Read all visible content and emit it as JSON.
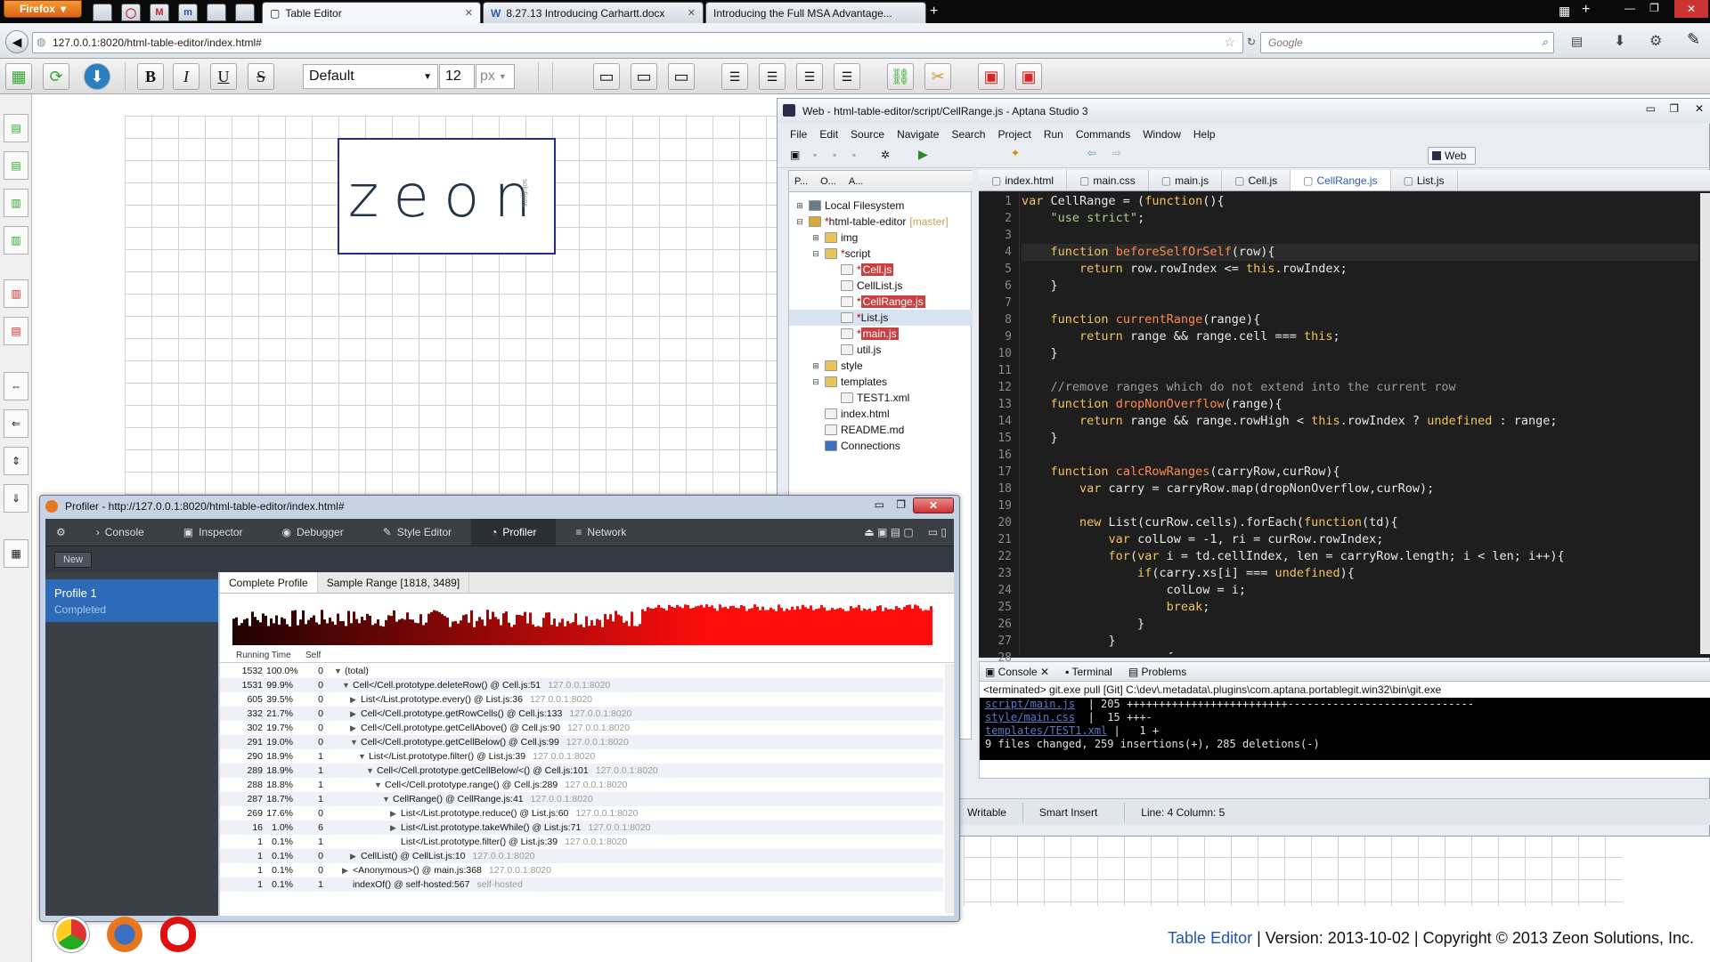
{
  "browser": {
    "menu_label": "Firefox",
    "pinned": [
      "",
      "",
      "M",
      "m",
      "",
      ""
    ],
    "tabs": [
      {
        "label": "Table Editor",
        "active": true
      },
      {
        "label": "8.27.13 Introducing Carhartt.docx",
        "active": false
      },
      {
        "label": "Introducing the Full MSA Advantage...",
        "active": false
      }
    ],
    "url": "127.0.0.1:8020/html-table-editor/index.html#",
    "search_placeholder": "Google"
  },
  "toolbar": {
    "bold": "B",
    "italic": "I",
    "underline": "U",
    "strike": "S",
    "font": "Default",
    "font_size": "12",
    "unit": "px"
  },
  "logo": {
    "text": "zeon",
    "tagline": "solutions"
  },
  "aptana": {
    "title": "Web - html-table-editor/script/CellRange.js - Aptana Studio 3",
    "menu": [
      "File",
      "Edit",
      "Source",
      "Navigate",
      "Search",
      "Project",
      "Run",
      "Commands",
      "Window",
      "Help"
    ],
    "perspective": "Web",
    "project_tabs": [
      "P...",
      "O...",
      "A..."
    ],
    "tree": [
      {
        "indent": 0,
        "tw": "⊞",
        "label": "Local Filesystem",
        "color": "#6b7b8c"
      },
      {
        "indent": 0,
        "tw": "⊟",
        "label": "html-table-editor",
        "suffix": "[master]",
        "mod": true,
        "color": "#d8a93a"
      },
      {
        "indent": 1,
        "tw": "⊞",
        "label": "img",
        "color": "#e6c45a"
      },
      {
        "indent": 1,
        "tw": "⊟",
        "label": "script",
        "mod": true,
        "color": "#e6c45a"
      },
      {
        "indent": 2,
        "tw": "",
        "label": "Cell.js",
        "mod": true,
        "hl": true,
        "color": "#f2f2f2"
      },
      {
        "indent": 2,
        "tw": "",
        "label": "CellList.js",
        "color": "#f2f2f2"
      },
      {
        "indent": 2,
        "tw": "",
        "label": "CellRange.js",
        "mod": true,
        "hl": true,
        "color": "#f2f2f2"
      },
      {
        "indent": 2,
        "tw": "",
        "label": "List.js",
        "mod": true,
        "sel": true,
        "color": "#f2f2f2"
      },
      {
        "indent": 2,
        "tw": "",
        "label": "main.js",
        "mod": true,
        "hl": true,
        "color": "#f2f2f2"
      },
      {
        "indent": 2,
        "tw": "",
        "label": "util.js",
        "color": "#f2f2f2"
      },
      {
        "indent": 1,
        "tw": "⊞",
        "label": "style",
        "color": "#e6c45a"
      },
      {
        "indent": 1,
        "tw": "⊟",
        "label": "templates",
        "color": "#e6c45a"
      },
      {
        "indent": 2,
        "tw": "",
        "label": "TEST1.xml",
        "color": "#f2f2f2"
      },
      {
        "indent": 1,
        "tw": "",
        "label": "index.html",
        "color": "#f2f2f2"
      },
      {
        "indent": 1,
        "tw": "",
        "label": "README.md",
        "color": "#f2f2f2"
      },
      {
        "indent": 1,
        "tw": "",
        "label": "Connections",
        "color": "#3a6fc2"
      }
    ],
    "editor_tabs": [
      {
        "label": "index.html",
        "active": false
      },
      {
        "label": "main.css",
        "active": false
      },
      {
        "label": "main.js",
        "active": false
      },
      {
        "label": "Cell.js",
        "active": false
      },
      {
        "label": "CellRange.js",
        "active": true
      },
      {
        "label": "List.js",
        "active": false
      }
    ],
    "code_lines": [
      "1",
      "2",
      "3",
      "4",
      "5",
      "6",
      "7",
      "8",
      "9",
      "10",
      "11",
      "12",
      "13",
      "14",
      "15",
      "16",
      "17",
      "18",
      "19",
      "20",
      "21",
      "22",
      "23",
      "24",
      "25",
      "26",
      "27",
      "28"
    ],
    "console_tabs": [
      "Console",
      "Terminal",
      "Problems"
    ],
    "console_header": "<terminated> git.exe pull [Git] C:\\dev\\.metadata\\.plugins\\com.aptana.portablegit.win32\\bin\\git.exe",
    "console_rows": [
      {
        "file": "script/main.js",
        "rest": "  | 205 +++++++++++++++++++++++++-----------------------------"
      },
      {
        "file": "style/main.css",
        "rest": "  |  15 +++-"
      },
      {
        "file": "templates/TEST1.xml",
        "rest": " |   1 +"
      },
      {
        "file": "",
        "rest": "9 files changed, 259 insertions(+), 285 deletions(-)"
      }
    ],
    "status": [
      "Writable",
      "Smart Insert",
      "Line: 4 Column: 5"
    ]
  },
  "profiler": {
    "title": "Profiler - http://127.0.0.1:8020/html-table-editor/index.html#",
    "tabs": [
      {
        "label": "Console",
        "active": false
      },
      {
        "label": "Inspector",
        "active": false
      },
      {
        "label": "Debugger",
        "active": false
      },
      {
        "label": "Style Editor",
        "active": false
      },
      {
        "label": "Profiler",
        "active": true
      },
      {
        "label": "Network",
        "active": false
      }
    ],
    "new_label": "New",
    "profile_name": "Profile 1",
    "profile_status": "Completed",
    "subtabs": [
      {
        "label": "Complete Profile",
        "active": true
      },
      {
        "label": "Sample Range [1818, 3489]",
        "active": false
      }
    ],
    "col_running": "Running Time",
    "col_self": "Self",
    "rows": [
      {
        "rt": "1532",
        "pc": "100.0%",
        "self": "0",
        "depth": 0,
        "tw": "▼",
        "fn": "(total)",
        "loc": ""
      },
      {
        "rt": "1531",
        "pc": "99.9%",
        "self": "0",
        "depth": 1,
        "tw": "▼",
        "fn": "Cell</Cell.prototype.deleteRow() @ Cell.js:51",
        "loc": "127.0.0.1:8020"
      },
      {
        "rt": "605",
        "pc": "39.5%",
        "self": "0",
        "depth": 2,
        "tw": "▶",
        "fn": "List</List.prototype.every() @ List.js:36",
        "loc": "127.0.0.1:8020"
      },
      {
        "rt": "332",
        "pc": "21.7%",
        "self": "0",
        "depth": 2,
        "tw": "▶",
        "fn": "Cell</Cell.prototype.getRowCells() @ Cell.js:133",
        "loc": "127.0.0.1:8020"
      },
      {
        "rt": "302",
        "pc": "19.7%",
        "self": "0",
        "depth": 2,
        "tw": "▶",
        "fn": "Cell</Cell.prototype.getCellAbove() @ Cell.js:90",
        "loc": "127.0.0.1:8020"
      },
      {
        "rt": "291",
        "pc": "19.0%",
        "self": "0",
        "depth": 2,
        "tw": "▼",
        "fn": "Cell</Cell.prototype.getCellBelow() @ Cell.js:99",
        "loc": "127.0.0.1:8020"
      },
      {
        "rt": "290",
        "pc": "18.9%",
        "self": "1",
        "depth": 3,
        "tw": "▼",
        "fn": "List</List.prototype.filter() @ List.js:39",
        "loc": "127.0.0.1:8020"
      },
      {
        "rt": "289",
        "pc": "18.9%",
        "self": "1",
        "depth": 4,
        "tw": "▼",
        "fn": "Cell</Cell.prototype.getCellBelow/<() @ Cell.js:101",
        "loc": "127.0.0.1:8020"
      },
      {
        "rt": "288",
        "pc": "18.8%",
        "self": "1",
        "depth": 5,
        "tw": "▼",
        "fn": "Cell</Cell.prototype.range() @ Cell.js:289",
        "loc": "127.0.0.1:8020"
      },
      {
        "rt": "287",
        "pc": "18.7%",
        "self": "1",
        "depth": 6,
        "tw": "▼",
        "fn": "CellRange() @ CellRange.js:41",
        "loc": "127.0.0.1:8020"
      },
      {
        "rt": "269",
        "pc": "17.6%",
        "self": "0",
        "depth": 7,
        "tw": "▶",
        "fn": "List</List.prototype.reduce() @ List.js:60",
        "loc": "127.0.0.1:8020"
      },
      {
        "rt": "16",
        "pc": "1.0%",
        "self": "6",
        "depth": 7,
        "tw": "▶",
        "fn": "List</List.prototype.takeWhile() @ List.js:71",
        "loc": "127.0.0.1:8020"
      },
      {
        "rt": "1",
        "pc": "0.1%",
        "self": "1",
        "depth": 7,
        "tw": "",
        "fn": "List</List.prototype.filter() @ List.js:39",
        "loc": "127.0.0.1:8020"
      },
      {
        "rt": "1",
        "pc": "0.1%",
        "self": "0",
        "depth": 2,
        "tw": "▶",
        "fn": "CellList() @ CellList.js:10",
        "loc": "127.0.0.1:8020"
      },
      {
        "rt": "1",
        "pc": "0.1%",
        "self": "0",
        "depth": 1,
        "tw": "▶",
        "fn": "<Anonymous>() @ main.js:368",
        "loc": "127.0.0.1:8020"
      },
      {
        "rt": "1",
        "pc": "0.1%",
        "self": "1",
        "depth": 1,
        "tw": "",
        "fn": "indexOf() @ self-hosted:567",
        "loc": "self-hosted"
      }
    ]
  },
  "footer": {
    "link": "Table Editor",
    "rest": " | Version: 2013-10-02 | Copyright © 2013 Zeon Solutions, Inc."
  },
  "colors": {
    "accent": "#2d6ab8",
    "profile_bar": "#ff1a1a",
    "firefox": "#e8761f"
  }
}
